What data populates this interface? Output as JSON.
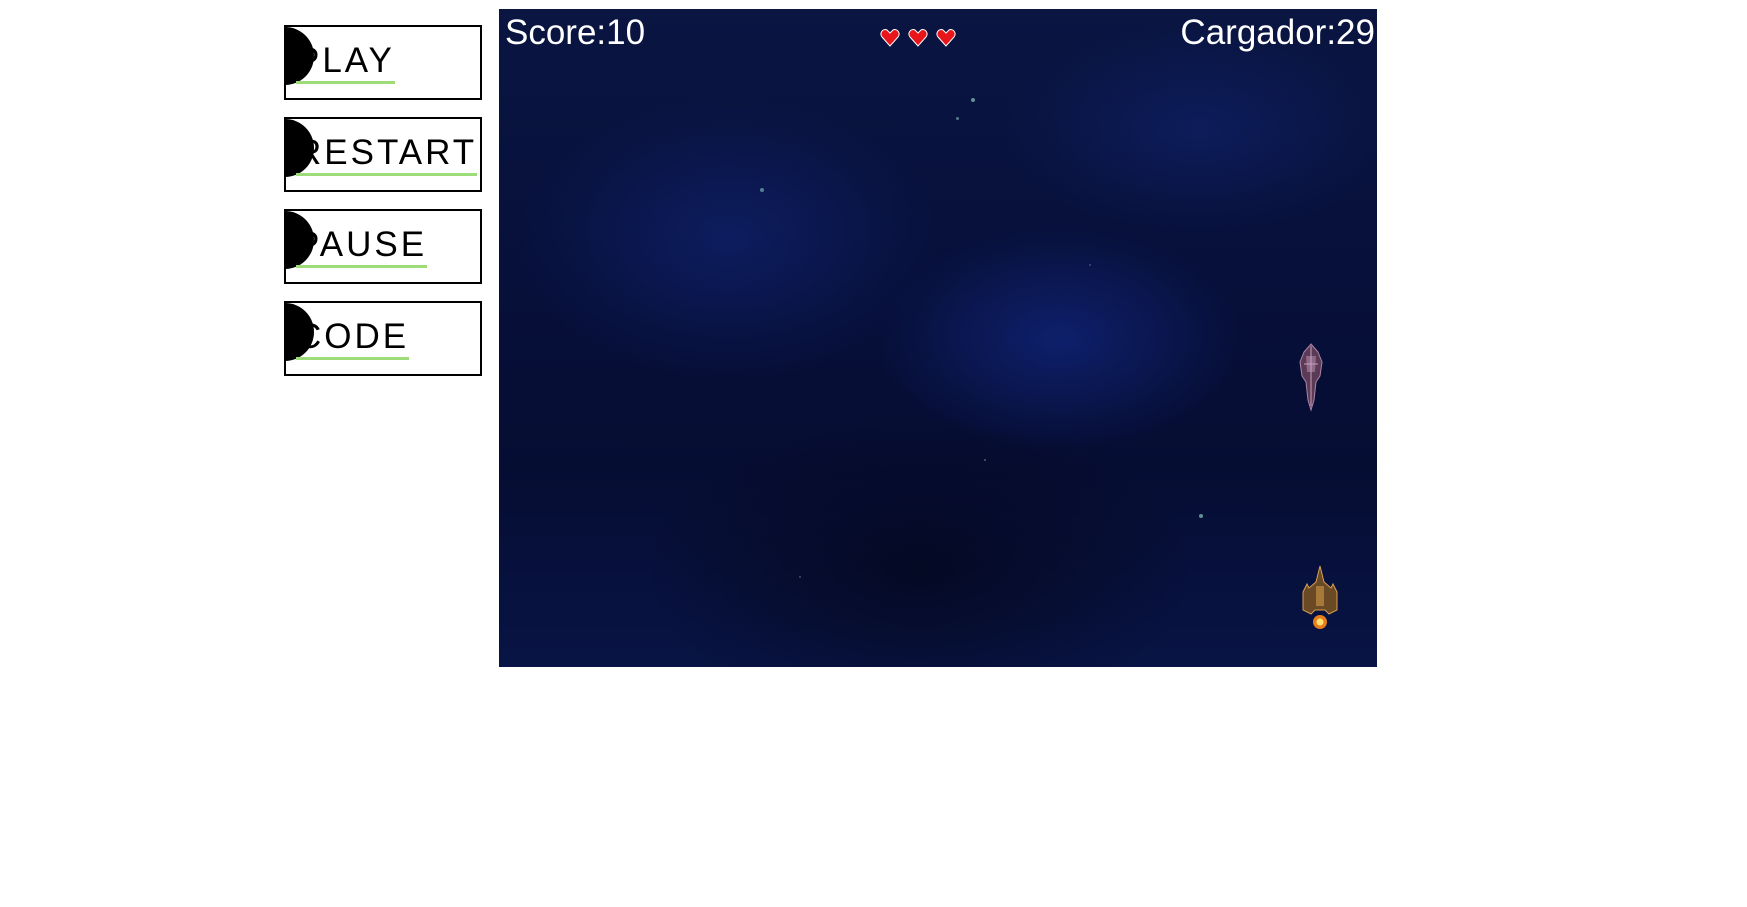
{
  "menu": {
    "buttons": [
      {
        "label": "PLAY"
      },
      {
        "label": "RESTART"
      },
      {
        "label": "PAUSE"
      },
      {
        "label": "CODE"
      }
    ]
  },
  "game": {
    "score_text": "Score:10",
    "ammo_text": "Cargador:29",
    "lives": 3,
    "colors": {
      "heart": "#e8161b",
      "button_underline": "#9edc7a",
      "space_background": "#07103a"
    },
    "icons": {
      "life": "heart-icon",
      "enemy": "enemy-ship-icon",
      "player": "player-ship-icon"
    }
  }
}
